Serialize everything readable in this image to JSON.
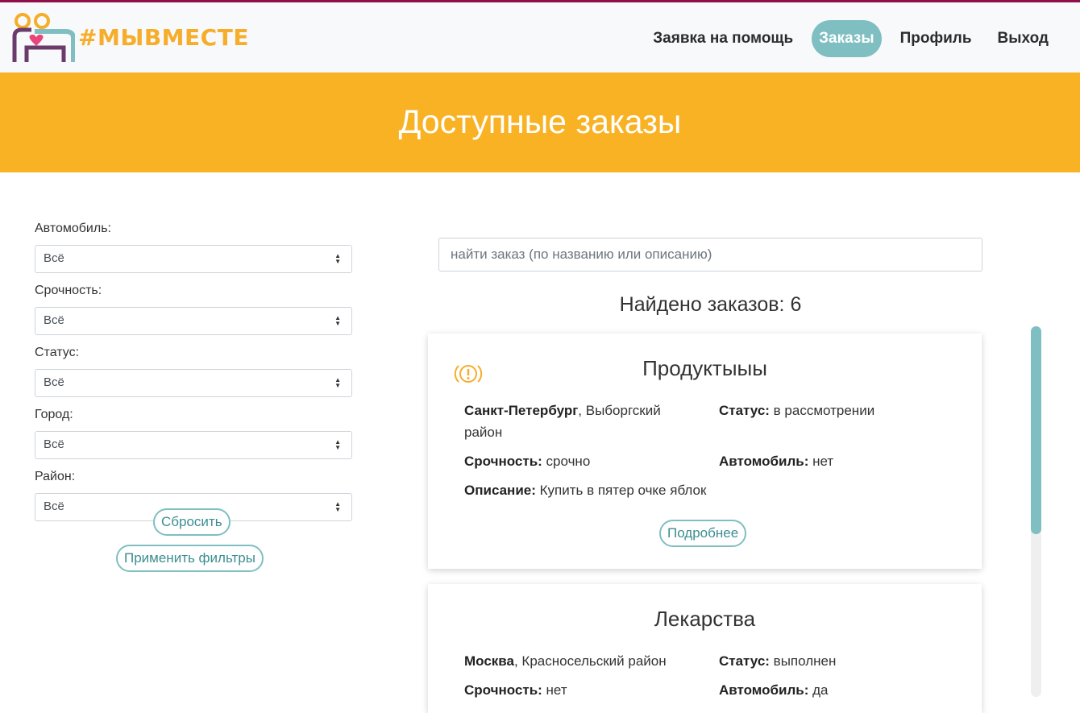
{
  "brand": {
    "name": "#МЫВМЕСТЕ"
  },
  "nav": {
    "items": [
      {
        "label": "Заявка на помощь",
        "active": false
      },
      {
        "label": "Заказы",
        "active": true
      },
      {
        "label": "Профиль",
        "active": false
      },
      {
        "label": "Выход",
        "active": false
      }
    ]
  },
  "hero": {
    "title": "Доступные заказы"
  },
  "filters": {
    "car": {
      "label": "Автомобиль:",
      "value": "Всё"
    },
    "urgency": {
      "label": "Срочность:",
      "value": "Всё"
    },
    "status": {
      "label": "Статус:",
      "value": "Всё"
    },
    "city": {
      "label": "Город:",
      "value": "Всё"
    },
    "district": {
      "label": "Район:",
      "value": "Всё"
    },
    "reset_label": "Сбросить",
    "apply_label": "Применить фильтры"
  },
  "search": {
    "placeholder": "найти заказ (по названию или описанию)"
  },
  "results": {
    "found_text": "Найдено заказов: 6"
  },
  "orders": [
    {
      "title": "Продуктыыы",
      "city": "Санкт-Петербург",
      "district": ", Выборгский район",
      "status_label": "Статус:",
      "status_value": " в рассмотрении",
      "urgency_label": "Срочность:",
      "urgency_value": " срочно",
      "car_label": "Автомобиль:",
      "car_value": " нет",
      "desc_label": "Описание:",
      "desc_value": " Купить в пятер очке яблок",
      "more_label": "Подробнее"
    },
    {
      "title": "Лекарства",
      "city": "Москва",
      "district": ", Красносельский район",
      "status_label": "Статус:",
      "status_value": " выполнен",
      "urgency_label": "Срочность:",
      "urgency_value": " нет",
      "car_label": "Автомобиль:",
      "car_value": " да"
    }
  ],
  "colors": {
    "accent": "#7fbfc2",
    "hero": "#f9b224",
    "brand_text": "#f6ad2a",
    "topline": "#8e0f4a"
  },
  "icons": {
    "warning": "alert-circle-icon",
    "select_arrows": "sort-arrows-icon"
  }
}
